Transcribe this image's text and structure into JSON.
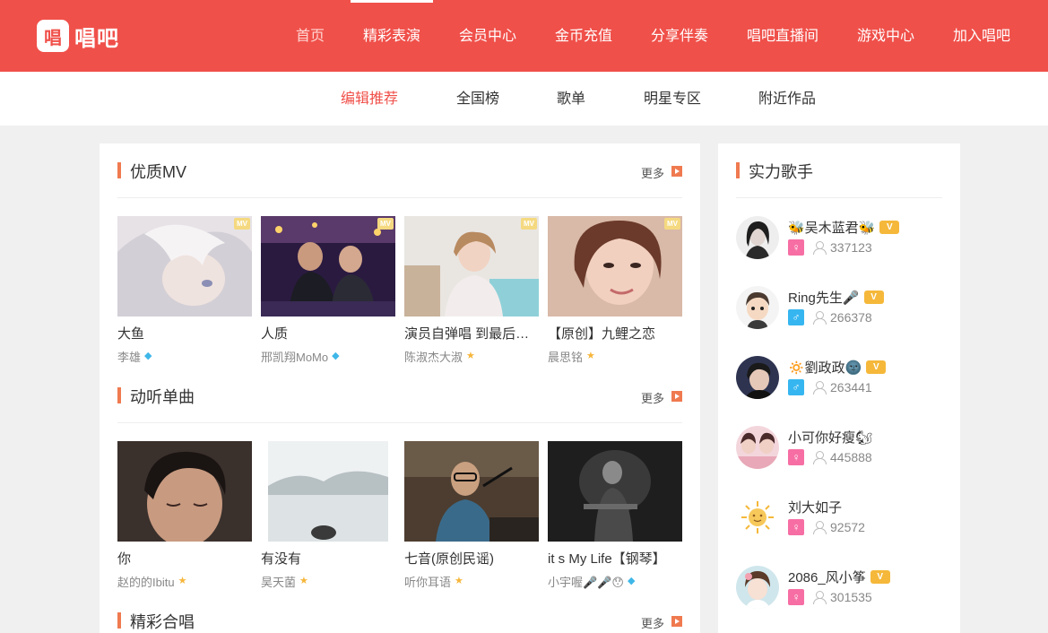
{
  "header": {
    "logo_glyph": "唱",
    "logo_text": "唱吧",
    "nav": [
      "首页",
      "精彩表演",
      "会员中心",
      "金币充值",
      "分享伴奏",
      "唱吧直播间",
      "游戏中心",
      "加入唱吧"
    ],
    "active_nav": "首页",
    "brand_color": "#f0504a"
  },
  "subnav": {
    "items": [
      "编辑推荐",
      "全国榜",
      "歌单",
      "明星专区",
      "附近作品"
    ],
    "active": "编辑推荐"
  },
  "sections": {
    "mv": {
      "title": "优质MV",
      "more": "更多",
      "badge": "MV",
      "items": [
        {
          "title": "大鱼",
          "author": "李雄",
          "badge": "diamond-icon"
        },
        {
          "title": "人质",
          "author": "邢凯翔MoMo",
          "badge": "diamond-icon"
        },
        {
          "title": "演员自弹唱 到最后…",
          "author": "陈淑杰大淑",
          "badge": "star-icon"
        },
        {
          "title": "【原创】九鲤之恋",
          "author": "晨思铭",
          "badge": "star-icon"
        }
      ]
    },
    "singles": {
      "title": "动听单曲",
      "more": "更多",
      "items": [
        {
          "title": "你",
          "author": "赵的的Ibitu",
          "badge": "star-icon"
        },
        {
          "title": "有没有",
          "author": "昊天菌",
          "badge": "star-icon"
        },
        {
          "title": "七音(原创民谣)",
          "author": "听你耳语",
          "badge": "star-icon"
        },
        {
          "title": "it s My Life【钢琴】",
          "author": "小宇喔🎤🎤😯",
          "badge": "diamond-icon"
        }
      ]
    },
    "chorus": {
      "title": "精彩合唱",
      "more": "更多"
    }
  },
  "singers": {
    "title": "实力歌手",
    "items": [
      {
        "name": "🐝吴木蓝君🐝",
        "gender": "♀",
        "fans": "337123",
        "vip": "V"
      },
      {
        "name": "Ring先生🎤",
        "gender": "♂",
        "fans": "266378",
        "vip": "V"
      },
      {
        "name": "🔅劉政政🌚",
        "gender": "♂",
        "fans": "263441",
        "vip": "V"
      },
      {
        "name": "小可你好瘦🐿",
        "gender": "♀",
        "fans": "445888",
        "vip": ""
      },
      {
        "name": "刘大如子",
        "gender": "♀",
        "fans": "92572",
        "vip": ""
      },
      {
        "name": "2086_风小筝",
        "gender": "♀",
        "fans": "301535",
        "vip": "V"
      }
    ]
  }
}
